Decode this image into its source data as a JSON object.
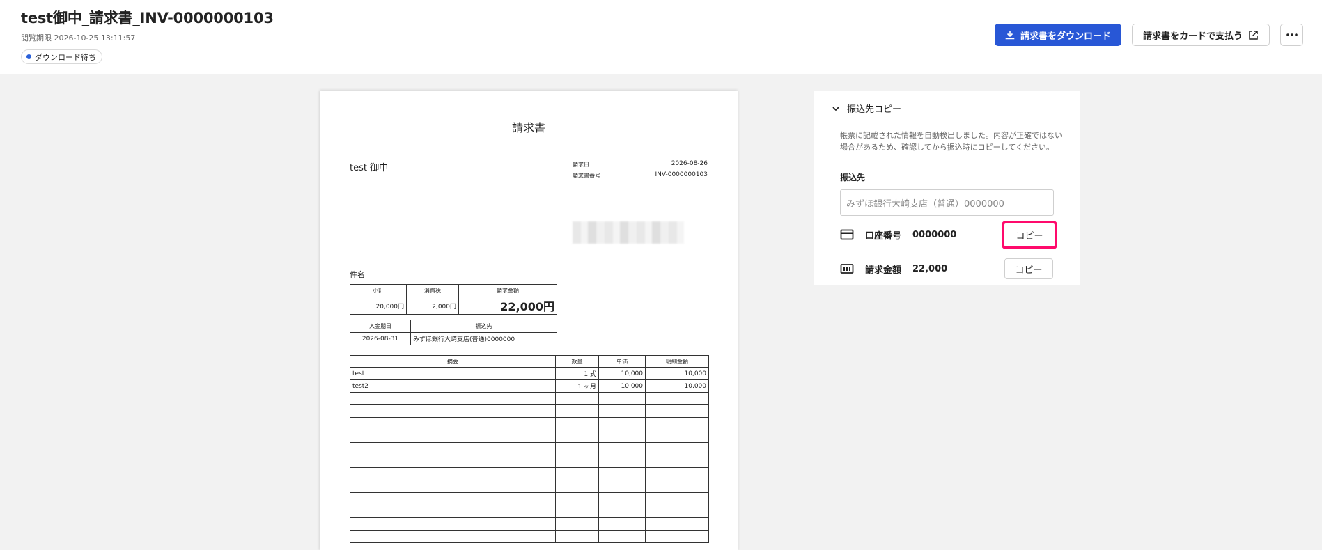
{
  "header": {
    "title": "test御中_請求書_INV-0000000103",
    "deadline": "閲覧期限 2026-10-25 13:11:57",
    "status": "ダウンロード待ち",
    "download_label": "請求書をダウンロード",
    "card_pay_label": "請求書をカードで支払う",
    "icons": {
      "download": "download-icon",
      "external": "external-link-icon",
      "more": "more-icon"
    },
    "colors": {
      "primary": "#2857d6",
      "status_dot": "#2b61d9"
    }
  },
  "invoice": {
    "doc_title": "請求書",
    "recipient": "test 御中",
    "meta": [
      {
        "label": "請求日",
        "value": "2026-08-26"
      },
      {
        "label": "請求書番号",
        "value": "INV-0000000103"
      }
    ],
    "subject_label": "件名",
    "summary": {
      "headers": [
        "小計",
        "消費税",
        "請求金額"
      ],
      "values": [
        "20,000円",
        "2,000円",
        "22,000円"
      ]
    },
    "bank": {
      "headers": [
        "入金期日",
        "振込先"
      ],
      "values": [
        "2026-08-31",
        "みずほ銀行大崎支店(普通)0000000"
      ]
    },
    "items": {
      "headers": [
        "摘要",
        "数量",
        "単価",
        "明細金額"
      ],
      "rows": [
        [
          "test",
          "1 式",
          "10,000",
          "10,000"
        ],
        [
          "test2",
          "1 ヶ月",
          "10,000",
          "10,000"
        ]
      ],
      "empty_rows": 12
    }
  },
  "panel": {
    "title": "振込先コピー",
    "description": "帳票に記載された情報を自動検出しました。内容が正確ではない場合があるため、確認してから振込時にコピーしてください。",
    "dest_label": "振込先",
    "dest_value": "みずほ銀行大崎支店（普通）0000000",
    "account_label": "口座番号",
    "account_value": "0000000",
    "amount_label": "請求金額",
    "amount_value": "22,000",
    "copy_label": "コピー",
    "icons": {
      "collapse": "chevron-down-icon",
      "account": "card-icon",
      "amount": "money-icon"
    },
    "colors": {
      "highlight": "#ff0a6c"
    }
  }
}
